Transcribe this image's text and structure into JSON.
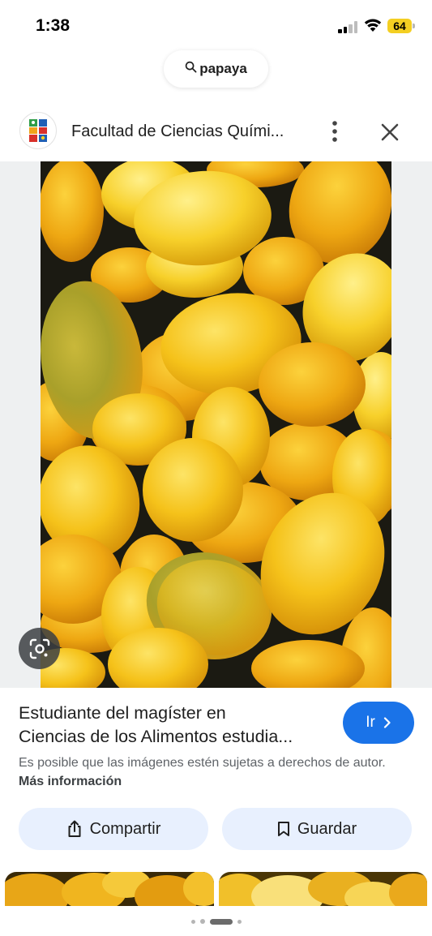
{
  "status_bar": {
    "time": "1:38",
    "battery": "64"
  },
  "search": {
    "query": "papaya",
    "icon": "search-icon"
  },
  "source": {
    "name": "Facultad de Ciencias Quími...",
    "logo_icon": "faculty-logo-icon",
    "menu_icon": "more-vertical-icon",
    "close_icon": "close-icon"
  },
  "image": {
    "lens_icon": "google-lens-icon"
  },
  "result": {
    "title_line1": "Estudiante del magíster en",
    "title_line2": "Ciencias de los Alimentos estudia...",
    "go_label": "Ir",
    "copyright_text": "Es posible que las imágenes estén sujetas a derechos de autor.",
    "more_info_label": "Más información"
  },
  "actions": {
    "share_label": "Compartir",
    "share_icon": "share-icon",
    "save_label": "Guardar",
    "save_icon": "bookmark-icon"
  },
  "colors": {
    "accent": "#1a73e8",
    "action_button_bg": "#e8f0fe",
    "battery": "#f4cf22"
  }
}
